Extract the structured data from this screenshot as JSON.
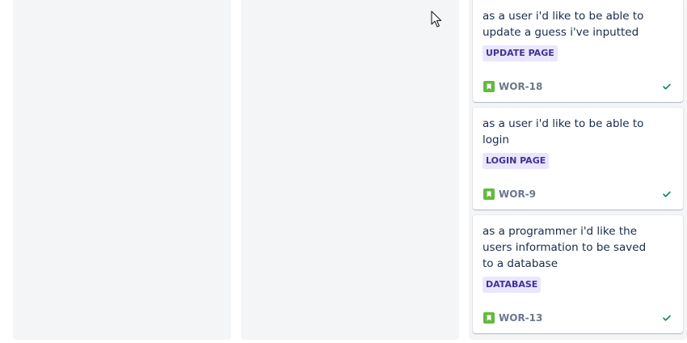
{
  "board": {
    "columns": [
      "",
      "",
      ""
    ],
    "cards": [
      {
        "title": "as a user i'd like to be able to update a guess i've inputted",
        "label": "UPDATE PAGE",
        "issue_key": "WOR-18",
        "issue_type_icon": "story-icon",
        "status_icon": "check-icon"
      },
      {
        "title": "as a user i'd like to be able to login",
        "label": "LOGIN PAGE",
        "issue_key": "WOR-9",
        "issue_type_icon": "story-icon",
        "status_icon": "check-icon"
      },
      {
        "title": "as a programmer i'd like the users information to be saved to a database",
        "label": "DATABASE",
        "issue_key": "WOR-13",
        "issue_type_icon": "story-icon",
        "status_icon": "check-icon"
      }
    ]
  },
  "colors": {
    "column_bg": "#f4f5f7",
    "label_bg": "#eae6ff",
    "label_text": "#403294",
    "story_icon": "#63ba3c",
    "done_check": "#00875a",
    "text": "#172b4d",
    "muted": "#6b778c"
  }
}
